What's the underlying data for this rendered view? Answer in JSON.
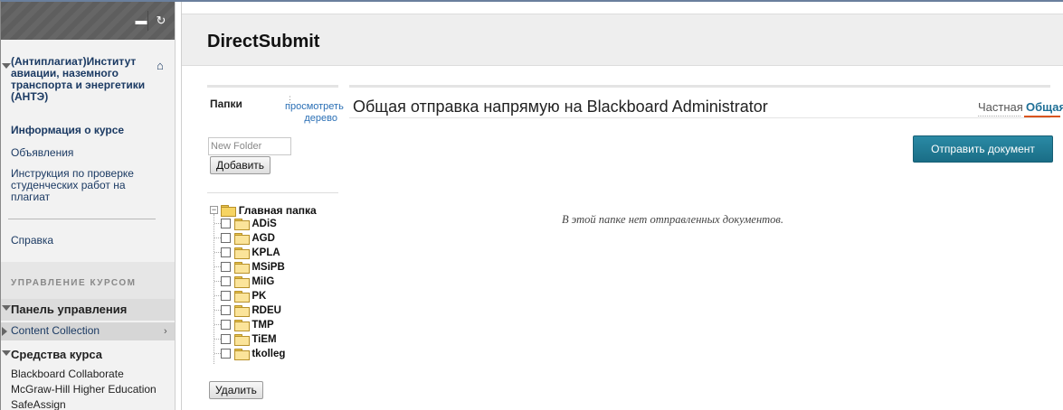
{
  "sidebar": {
    "course_title": "(Антиплагиат)Институт авиации, наземного транспорта и энергетики (АНТЭ)",
    "items": [
      {
        "label": "Информация о курсе"
      },
      {
        "label": "Объявления"
      },
      {
        "label": "Инструкция по проверке студенческих работ на плагиат"
      },
      {
        "label": "Справка"
      }
    ],
    "management_caption": "УПРАВЛЕНИЕ КУРСОМ",
    "control_panel": "Панель управления",
    "content_collection": "Content Collection",
    "course_tools": "Средства курса",
    "tools": [
      "Blackboard Collaborate",
      "McGraw-Hill Higher Education",
      "SafeAssign"
    ]
  },
  "header": {
    "title": "DirectSubmit"
  },
  "folders_panel": {
    "label": "Папки",
    "tree_view_link": "просмотреть дерево",
    "new_folder_placeholder": "New Folder",
    "add_button": "Добавить",
    "delete_button": "Удалить",
    "root_folder": "Главная папка",
    "folders": [
      "ADiS",
      "AGD",
      "KPLA",
      "MSiPB",
      "MiIG",
      "PK",
      "RDEU",
      "TMP",
      "TiEM",
      "tkolleg"
    ]
  },
  "content": {
    "title": "Общая отправка напрямую на Blackboard Administrator",
    "tab_private": "Частная",
    "tab_common": "Общая",
    "submit_button": "Отправить документ",
    "empty_message": "В этой папке нет отправленных документов."
  },
  "colors": {
    "accent": "#1e6f96",
    "tab_underline": "#d9541e",
    "link": "#2a6fb5"
  }
}
